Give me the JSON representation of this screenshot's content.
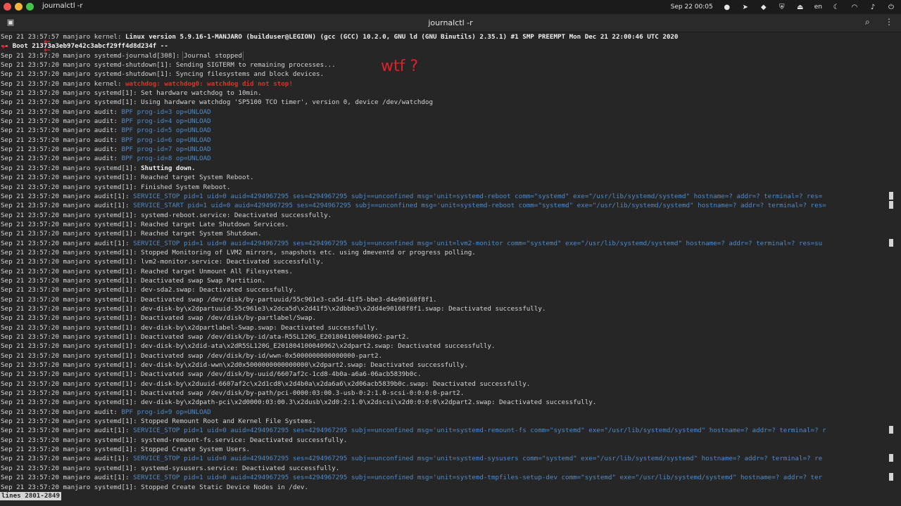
{
  "system_bar": {
    "app_name": "journalctl -r",
    "datetime": "Sep 22  00:05",
    "lang": "en"
  },
  "window": {
    "title": "journalctl -r"
  },
  "annotation": "wtf ?",
  "status": "lines 2801-2849",
  "lines": [
    {
      "p": "Sep 21 23:57:57 manjaro kernel: ",
      "m": "Linux version 5.9.16-1-MANJARO (builduser@LEGION) (gcc (GCC) 10.2.0, GNU ld (GNU Binutils) 2.35.1) #1 SMP PREEMPT Mon Dec 21 22:00:46 UTC 2020",
      "s": "bold"
    },
    {
      "p": "",
      "m": "-- Boot 21373a3eb97e42c3abcf29ff4d8d234f --",
      "s": "boot"
    },
    {
      "p": "Sep 21 23:57:20 manjaro systemd-journald[308]: ",
      "m": "Journal stopped",
      "s": "boxed"
    },
    {
      "p": "Sep 21 23:57:20 manjaro systemd-shutdown[1]: ",
      "m": "Sending SIGTERM to remaining processes...",
      "s": ""
    },
    {
      "p": "Sep 21 23:57:20 manjaro systemd-shutdown[1]: ",
      "m": "Syncing filesystems and block devices.",
      "s": ""
    },
    {
      "p": "Sep 21 23:57:20 manjaro kernel: ",
      "m": "watchdog: watchdog0: watchdog did not stop!",
      "s": "red"
    },
    {
      "p": "Sep 21 23:57:20 manjaro systemd[1]: ",
      "m": "Set hardware watchdog to 10min.",
      "s": ""
    },
    {
      "p": "Sep 21 23:57:20 manjaro systemd[1]: ",
      "m": "Using hardware watchdog 'SP5100 TCO timer', version 0, device /dev/watchdog",
      "s": ""
    },
    {
      "p": "Sep 21 23:57:20 manjaro audit: ",
      "m": "BPF prog-id=3 op=UNLOAD",
      "s": "blue"
    },
    {
      "p": "Sep 21 23:57:20 manjaro audit: ",
      "m": "BPF prog-id=4 op=UNLOAD",
      "s": "blue"
    },
    {
      "p": "Sep 21 23:57:20 manjaro audit: ",
      "m": "BPF prog-id=5 op=UNLOAD",
      "s": "blue"
    },
    {
      "p": "Sep 21 23:57:20 manjaro audit: ",
      "m": "BPF prog-id=6 op=UNLOAD",
      "s": "blue"
    },
    {
      "p": "Sep 21 23:57:20 manjaro audit: ",
      "m": "BPF prog-id=7 op=UNLOAD",
      "s": "blue"
    },
    {
      "p": "Sep 21 23:57:20 manjaro audit: ",
      "m": "BPF prog-id=8 op=UNLOAD",
      "s": "blue"
    },
    {
      "p": "Sep 21 23:57:20 manjaro systemd[1]: ",
      "m": "Shutting down.",
      "s": "bold"
    },
    {
      "p": "Sep 21 23:57:20 manjaro systemd[1]: ",
      "m": "Reached target System Reboot.",
      "s": ""
    },
    {
      "p": "Sep 21 23:57:20 manjaro systemd[1]: ",
      "m": "Finished System Reboot.",
      "s": ""
    },
    {
      "p": "Sep 21 23:57:20 manjaro audit[1]: ",
      "m": "SERVICE_STOP pid=1 uid=0 auid=4294967295 ses=4294967295 subj==unconfined msg='unit=systemd-reboot comm=\"systemd\" exe=\"/usr/lib/systemd/systemd\" hostname=? addr=? terminal=? res=",
      "s": "blue",
      "t": true
    },
    {
      "p": "Sep 21 23:57:20 manjaro audit[1]: ",
      "m": "SERVICE_START pid=1 uid=0 auid=4294967295 ses=4294967295 subj==unconfined msg='unit=systemd-reboot comm=\"systemd\" exe=\"/usr/lib/systemd/systemd\" hostname=? addr=? terminal=? res=",
      "s": "blue",
      "t": true
    },
    {
      "p": "Sep 21 23:57:20 manjaro systemd[1]: ",
      "m": "systemd-reboot.service: Deactivated successfully.",
      "s": ""
    },
    {
      "p": "Sep 21 23:57:20 manjaro systemd[1]: ",
      "m": "Reached target Late Shutdown Services.",
      "s": ""
    },
    {
      "p": "Sep 21 23:57:20 manjaro systemd[1]: ",
      "m": "Reached target System Shutdown.",
      "s": ""
    },
    {
      "p": "Sep 21 23:57:20 manjaro audit[1]: ",
      "m": "SERVICE_STOP pid=1 uid=0 auid=4294967295 ses=4294967295 subj==unconfined msg='unit=lvm2-monitor comm=\"systemd\" exe=\"/usr/lib/systemd/systemd\" hostname=? addr=? terminal=? res=su",
      "s": "blue",
      "t": true
    },
    {
      "p": "Sep 21 23:57:20 manjaro systemd[1]: ",
      "m": "Stopped Monitoring of LVM2 mirrors, snapshots etc. using dmeventd or progress polling.",
      "s": ""
    },
    {
      "p": "Sep 21 23:57:20 manjaro systemd[1]: ",
      "m": "lvm2-monitor.service: Deactivated successfully.",
      "s": ""
    },
    {
      "p": "Sep 21 23:57:20 manjaro systemd[1]: ",
      "m": "Reached target Unmount All Filesystems.",
      "s": ""
    },
    {
      "p": "Sep 21 23:57:20 manjaro systemd[1]: ",
      "m": "Deactivated swap Swap Partition.",
      "s": ""
    },
    {
      "p": "Sep 21 23:57:20 manjaro systemd[1]: ",
      "m": "dev-sda2.swap: Deactivated successfully.",
      "s": ""
    },
    {
      "p": "Sep 21 23:57:20 manjaro systemd[1]: ",
      "m": "Deactivated swap /dev/disk/by-partuuid/55c961e3-ca5d-41f5-bbe3-d4e90168f8f1.",
      "s": ""
    },
    {
      "p": "Sep 21 23:57:20 manjaro systemd[1]: ",
      "m": "dev-disk-by\\x2dpartuuid-55c961e3\\x2dca5d\\x2d41f5\\x2dbbe3\\x2dd4e90168f8f1.swap: Deactivated successfully.",
      "s": ""
    },
    {
      "p": "Sep 21 23:57:20 manjaro systemd[1]: ",
      "m": "Deactivated swap /dev/disk/by-partlabel/Swap.",
      "s": ""
    },
    {
      "p": "Sep 21 23:57:20 manjaro systemd[1]: ",
      "m": "dev-disk-by\\x2dpartlabel-Swap.swap: Deactivated successfully.",
      "s": ""
    },
    {
      "p": "Sep 21 23:57:20 manjaro systemd[1]: ",
      "m": "Deactivated swap /dev/disk/by-id/ata-R5SL120G_E201804100040962-part2.",
      "s": ""
    },
    {
      "p": "Sep 21 23:57:20 manjaro systemd[1]: ",
      "m": "dev-disk-by\\x2did-ata\\x2dR5SL120G_E201804100040962\\x2dpart2.swap: Deactivated successfully.",
      "s": ""
    },
    {
      "p": "Sep 21 23:57:20 manjaro systemd[1]: ",
      "m": "Deactivated swap /dev/disk/by-id/wwn-0x5000000000000000-part2.",
      "s": ""
    },
    {
      "p": "Sep 21 23:57:20 manjaro systemd[1]: ",
      "m": "dev-disk-by\\x2did-wwn\\x2d0x5000000000000000\\x2dpart2.swap: Deactivated successfully.",
      "s": ""
    },
    {
      "p": "Sep 21 23:57:20 manjaro systemd[1]: ",
      "m": "Deactivated swap /dev/disk/by-uuid/6607af2c-1cd8-4b0a-a6a6-06acb5839b0c.",
      "s": ""
    },
    {
      "p": "Sep 21 23:57:20 manjaro systemd[1]: ",
      "m": "dev-disk-by\\x2duuid-6607af2c\\x2d1cd8\\x2d4b0a\\x2da6a6\\x2d06acb5839b0c.swap: Deactivated successfully.",
      "s": ""
    },
    {
      "p": "Sep 21 23:57:20 manjaro systemd[1]: ",
      "m": "Deactivated swap /dev/disk/by-path/pci-0000:03:00.3-usb-0:2:1.0-scsi-0:0:0:0-part2.",
      "s": ""
    },
    {
      "p": "Sep 21 23:57:20 manjaro systemd[1]: ",
      "m": "dev-disk-by\\x2dpath-pci\\x2d0000:03:00.3\\x2dusb\\x2d0:2:1.0\\x2dscsi\\x2d0:0:0:0\\x2dpart2.swap: Deactivated successfully.",
      "s": ""
    },
    {
      "p": "Sep 21 23:57:20 manjaro audit: ",
      "m": "BPF prog-id=9 op=UNLOAD",
      "s": "blue"
    },
    {
      "p": "Sep 21 23:57:20 manjaro systemd[1]: ",
      "m": "Stopped Remount Root and Kernel File Systems.",
      "s": ""
    },
    {
      "p": "Sep 21 23:57:20 manjaro audit[1]: ",
      "m": "SERVICE_STOP pid=1 uid=0 auid=4294967295 ses=4294967295 subj==unconfined msg='unit=systemd-remount-fs comm=\"systemd\" exe=\"/usr/lib/systemd/systemd\" hostname=? addr=? terminal=? r",
      "s": "blue",
      "t": true
    },
    {
      "p": "Sep 21 23:57:20 manjaro systemd[1]: ",
      "m": "systemd-remount-fs.service: Deactivated successfully.",
      "s": ""
    },
    {
      "p": "Sep 21 23:57:20 manjaro systemd[1]: ",
      "m": "Stopped Create System Users.",
      "s": ""
    },
    {
      "p": "Sep 21 23:57:20 manjaro audit[1]: ",
      "m": "SERVICE_STOP pid=1 uid=0 auid=4294967295 ses=4294967295 subj==unconfined msg='unit=systemd-sysusers comm=\"systemd\" exe=\"/usr/lib/systemd/systemd\" hostname=? addr=? terminal=? re",
      "s": "blue",
      "t": true
    },
    {
      "p": "Sep 21 23:57:20 manjaro systemd[1]: ",
      "m": "systemd-sysusers.service: Deactivated successfully.",
      "s": ""
    },
    {
      "p": "Sep 21 23:57:20 manjaro audit[1]: ",
      "m": "SERVICE_STOP pid=1 uid=0 auid=4294967295 ses=4294967295 subj==unconfined msg='unit=systemd-tmpfiles-setup-dev comm=\"systemd\" exe=\"/usr/lib/systemd/systemd\" hostname=? addr=? ter",
      "s": "blue",
      "t": true
    },
    {
      "p": "Sep 21 23:57:20 manjaro systemd[1]: ",
      "m": "Stopped Create Static Device Nodes in /dev.",
      "s": ""
    }
  ]
}
